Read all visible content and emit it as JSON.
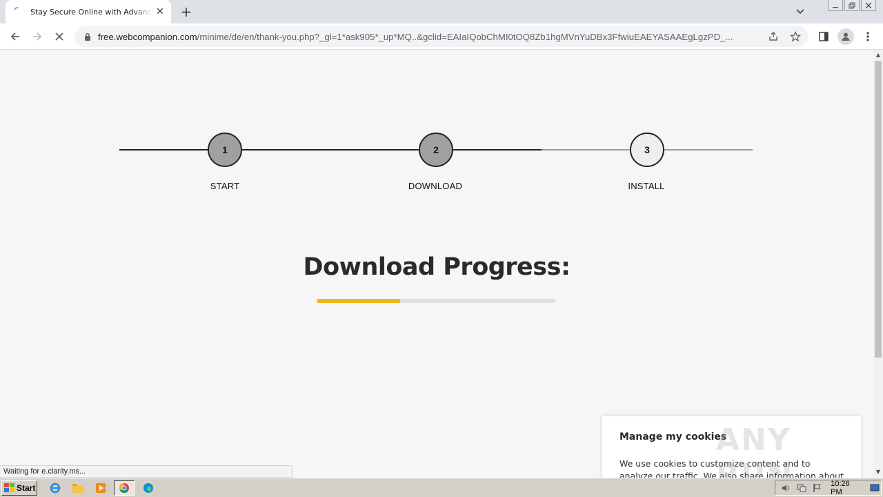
{
  "browser": {
    "tab_title": "Stay Secure Online with Advanced Antivirus",
    "url_host": "free.webcompanion.com",
    "url_path": "/minime/de/en/thank-you.php?_gl=1*ask905*_up*MQ..&gclid=EAIaIQobChMI0tOQ8Zb1hgMVnYuDBx3FfwiuEAEYASAAEgLgzPD_..."
  },
  "steps": [
    {
      "number": "1",
      "label": "START",
      "state": "done"
    },
    {
      "number": "2",
      "label": "DOWNLOAD",
      "state": "done"
    },
    {
      "number": "3",
      "label": "INSTALL",
      "state": "pending"
    }
  ],
  "main": {
    "heading": "Download Progress:",
    "progress_fraction": 0.35
  },
  "cookie_banner": {
    "title": "Manage my cookies",
    "text": "We use cookies to customize content and to analyze our traffic. We also share information about your use of our"
  },
  "watermark": "ANY RUN",
  "status_bar": "Waiting for e.clarity.ms...",
  "taskbar": {
    "start_label": "Start",
    "clock": "10:26 PM"
  },
  "colors": {
    "progress_fill": "#f2b619",
    "step_done_fill": "#a0a0a0",
    "step_pending_fill": "#eeeeee"
  }
}
